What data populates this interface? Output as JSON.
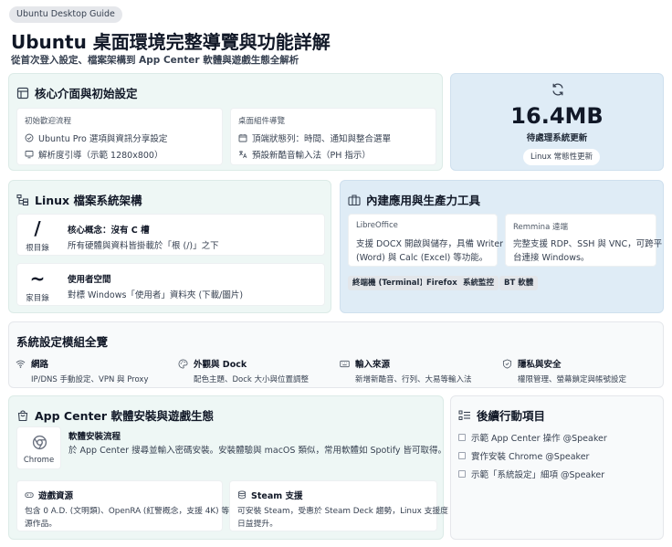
{
  "header": {
    "tag": "Ubuntu Desktop Guide",
    "title": "Ubuntu 桌面環境完整導覽與功能詳解",
    "subtitle": "從首次登入設定、檔案架構到 App Center 軟體與遊戲生態全解析"
  },
  "core": {
    "title": "核心介面與初始設定",
    "welcome": {
      "label": "初始歡迎流程",
      "items": [
        "Ubuntu Pro 選項與資訊分享設定",
        "解析度引導（示範 1280x800）"
      ]
    },
    "desktop": {
      "label": "桌面組件導覽",
      "items": [
        "頂端狀態列：時間、通知與整合選單",
        "預設新酷音輸入法（PH 指示）"
      ]
    }
  },
  "updates": {
    "value": "16.4MB",
    "label": "待處理系統更新",
    "pill": "Linux 常態性更新"
  },
  "filesystem": {
    "title": "Linux 檔案系統架構",
    "rows": [
      {
        "symbol": "/",
        "label": "根目錄",
        "heading": "核心概念：沒有 C 槽",
        "desc": "所有硬體與資料皆掛載於「根 (/)」之下"
      },
      {
        "symbol": "~",
        "label": "家目錄",
        "heading": "使用者空間",
        "desc": "對標 Windows「使用者」資料夾 (下載/圖片)"
      }
    ]
  },
  "apps": {
    "title": "內建應用與生產力工具",
    "libreoffice": {
      "label": "LibreOffice",
      "lines": [
        "支援 DOCX 開啟與儲存，具備 Writer",
        "(Word) 與 Calc (Excel) 等功能。"
      ]
    },
    "remmina": {
      "label": "Remmina 遠端",
      "lines": [
        "完整支援 RDP、SSH 與 VNC，可跨平",
        "台連接 Windows。"
      ]
    },
    "chips": [
      "終端機 (Terminal)",
      "Firefox",
      "系統監控",
      "BT 軟體"
    ]
  },
  "settings": {
    "title": "系統設定模組全覽",
    "modules": [
      {
        "icon": "wifi-icon",
        "title": "網路",
        "desc": "IP/DNS 手動設定、VPN 與 Proxy"
      },
      {
        "icon": "palette-icon",
        "title": "外觀與 Dock",
        "desc": "配色主題、Dock 大小與位置調整"
      },
      {
        "icon": "keyboard-icon",
        "title": "輸入來源",
        "desc": "新增新酷音、行列、大易等輸入法"
      },
      {
        "icon": "shield-icon",
        "title": "隱私與安全",
        "desc": "權限管理、螢幕鎖定與帳號設定"
      }
    ]
  },
  "appcenter": {
    "title": "App Center 軟體安裝與遊戲生態",
    "chrome_label": "Chrome",
    "install": {
      "heading": "軟體安裝流程",
      "desc": "於 App Center 搜尋並輸入密碼安裝。安裝體驗與 macOS 類似，常用軟體如 Spotify 皆可取得。"
    },
    "games": {
      "heading": "遊戲資源",
      "lines": [
        "包含 0 A.D. (文明類)、OpenRA (紅警概念，支援 4K) 等開",
        "源作品。"
      ]
    },
    "steam": {
      "heading": "Steam 支援",
      "lines": [
        "可安裝 Steam，受惠於 Steam Deck 趨勢，Linux 支援度",
        "日益提升。"
      ]
    }
  },
  "followup": {
    "title": "後續行動項目",
    "items": [
      "示範 App Center 操作 @Speaker",
      "實作安裝 Chrome @Speaker",
      "示範「系統設定」細項 @Speaker"
    ]
  },
  "colors": {
    "teal": "#eef7f5",
    "blue": "#dfecf6",
    "chrome_green": "#9ca3af"
  }
}
